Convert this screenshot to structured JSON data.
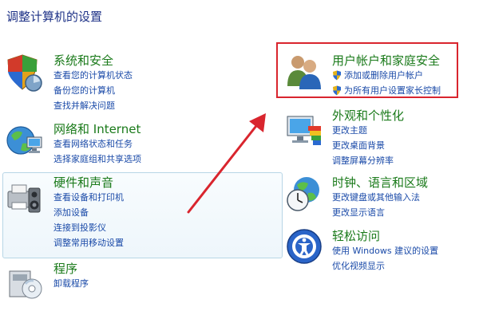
{
  "page": {
    "title": "调整计算机的设置"
  },
  "categories": [
    {
      "id": "system-security",
      "title": "系统和安全",
      "links": [
        "查看您的计算机状态",
        "备份您的计算机",
        "查找并解决问题"
      ]
    },
    {
      "id": "network",
      "title": "网络和 Internet",
      "links": [
        "查看网络状态和任务",
        "选择家庭组和共享选项"
      ]
    },
    {
      "id": "hardware",
      "title": "硬件和声音",
      "links": [
        "查看设备和打印机",
        "添加设备",
        "连接到投影仪",
        "调整常用移动设置"
      ]
    },
    {
      "id": "programs",
      "title": "程序",
      "links": [
        "卸载程序"
      ]
    },
    {
      "id": "user-accounts",
      "title": "用户帐户和家庭安全",
      "links": [
        "添加或删除用户帐户",
        "为所有用户设置家长控制"
      ]
    },
    {
      "id": "appearance",
      "title": "外观和个性化",
      "links": [
        "更改主题",
        "更改桌面背景",
        "调整屏幕分辨率"
      ]
    },
    {
      "id": "clock",
      "title": "时钟、语言和区域",
      "links": [
        "更改键盘或其他输入法",
        "更改显示语言"
      ]
    },
    {
      "id": "ease",
      "title": "轻松访问",
      "links": [
        "使用 Windows 建议的设置",
        "优化视频显示"
      ]
    }
  ],
  "colors": {
    "category_title": "#1a7a1a",
    "link": "#1a4aa8",
    "highlight": "#d9252e",
    "arrow": "#d9252e"
  }
}
